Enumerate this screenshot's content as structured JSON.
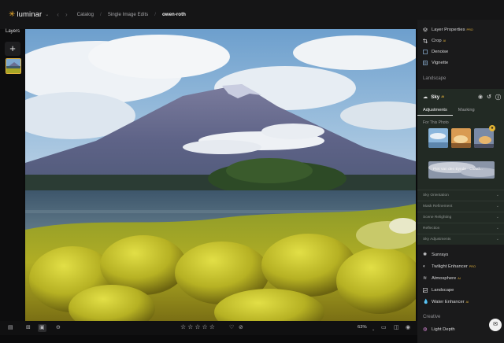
{
  "app": {
    "name": "luminar"
  },
  "breadcrumb": {
    "items": [
      "Catalog",
      "Single Image Edits"
    ],
    "current": "owen-roth"
  },
  "layers": {
    "title": "Layers",
    "add_icon": "+"
  },
  "toolbar": {
    "zoom": "63%",
    "rating_stars": [
      "☆",
      "☆",
      "☆",
      "☆",
      "☆"
    ]
  },
  "panel": {
    "top_items": [
      {
        "label": "Layer Properties",
        "pro": "PRO",
        "icon": "layers-icon"
      },
      {
        "label": "Crop",
        "pro": "AI",
        "icon": "crop-icon"
      },
      {
        "label": "Denoise",
        "pro": "",
        "icon": "denoise-icon"
      },
      {
        "label": "Vignette",
        "pro": "",
        "icon": "vignette-icon"
      }
    ],
    "landscape_header": "Landscape",
    "sky": {
      "title": "Sky",
      "pro": "AI",
      "tabs": [
        "Adjustments",
        "Masking"
      ],
      "for_this_photo": "For This Photo",
      "badge": "★",
      "selected_sky": "Piet Van den Eynde - Cloud...",
      "sub_sections": [
        "Sky Orientation",
        "Mask Refinement",
        "Scene Relighting",
        "Reflection",
        "Sky Adjustments"
      ]
    },
    "landscape_items": [
      {
        "label": "Sunrays",
        "pro": "",
        "icon": "sunrays-icon"
      },
      {
        "label": "Twilight Enhancer",
        "pro": "PRO",
        "icon": "twilight-icon"
      },
      {
        "label": "Atmosphere",
        "pro": "AI",
        "icon": "atmosphere-icon"
      },
      {
        "label": "Landscape",
        "pro": "",
        "icon": "landscape-icon"
      },
      {
        "label": "Water Enhancer",
        "pro": "AI",
        "icon": "water-icon"
      }
    ],
    "creative_header": "Creative",
    "creative_items": [
      {
        "label": "Light Depth",
        "pro": "",
        "icon": "light-depth-icon"
      }
    ]
  },
  "colors": {
    "accent": "#e5b533",
    "panel": "#1a1a1b",
    "sky_block": "#222a24"
  }
}
